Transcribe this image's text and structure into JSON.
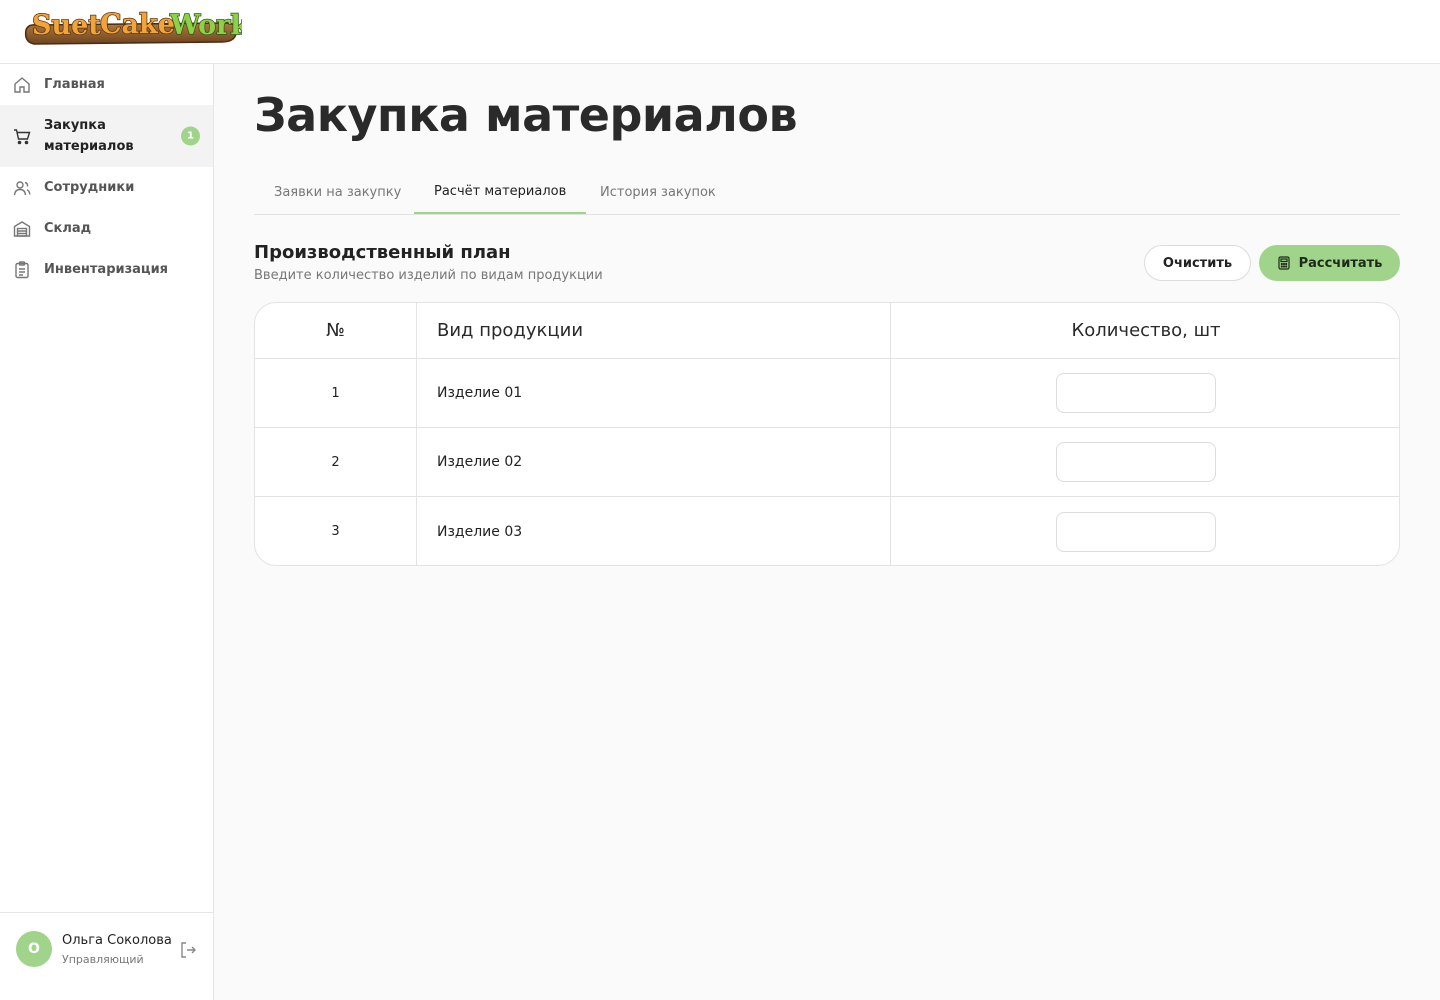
{
  "brand": {
    "logo_text": "Suet Cake Work",
    "colors": {
      "accent": "#9fd48a",
      "logo_orange": "#f0a43a",
      "logo_green": "#8fd04a",
      "logo_wood": "#8a5a2b"
    }
  },
  "sidebar": {
    "items": [
      {
        "label": "Главная",
        "icon": "home-icon"
      },
      {
        "label": "Закупка материалов",
        "icon": "cart-icon",
        "badge": "1",
        "active": true
      },
      {
        "label": "Сотрудники",
        "icon": "users-icon"
      },
      {
        "label": "Склад",
        "icon": "warehouse-icon"
      },
      {
        "label": "Инвентаризация",
        "icon": "clipboard-icon"
      }
    ],
    "user": {
      "initial": "О",
      "name": "Ольга Соколова",
      "role": "Управляющий"
    }
  },
  "main": {
    "title": "Закупка материалов",
    "tabs": [
      {
        "label": "Заявки на закупку"
      },
      {
        "label": "Расчёт материалов",
        "active": true
      },
      {
        "label": "История закупок"
      }
    ],
    "section": {
      "title": "Производственный план",
      "subtitle": "Введите количество изделий по видам продукции",
      "clear_label": "Очистить",
      "calc_label": "Рассчитать"
    },
    "table": {
      "columns": [
        "№",
        "Вид продукции",
        "Количество, шт"
      ],
      "rows": [
        {
          "num": "1",
          "name": "Изделие 01",
          "qty": ""
        },
        {
          "num": "2",
          "name": "Изделие 02",
          "qty": ""
        },
        {
          "num": "3",
          "name": "Изделие 03",
          "qty": ""
        }
      ]
    }
  }
}
